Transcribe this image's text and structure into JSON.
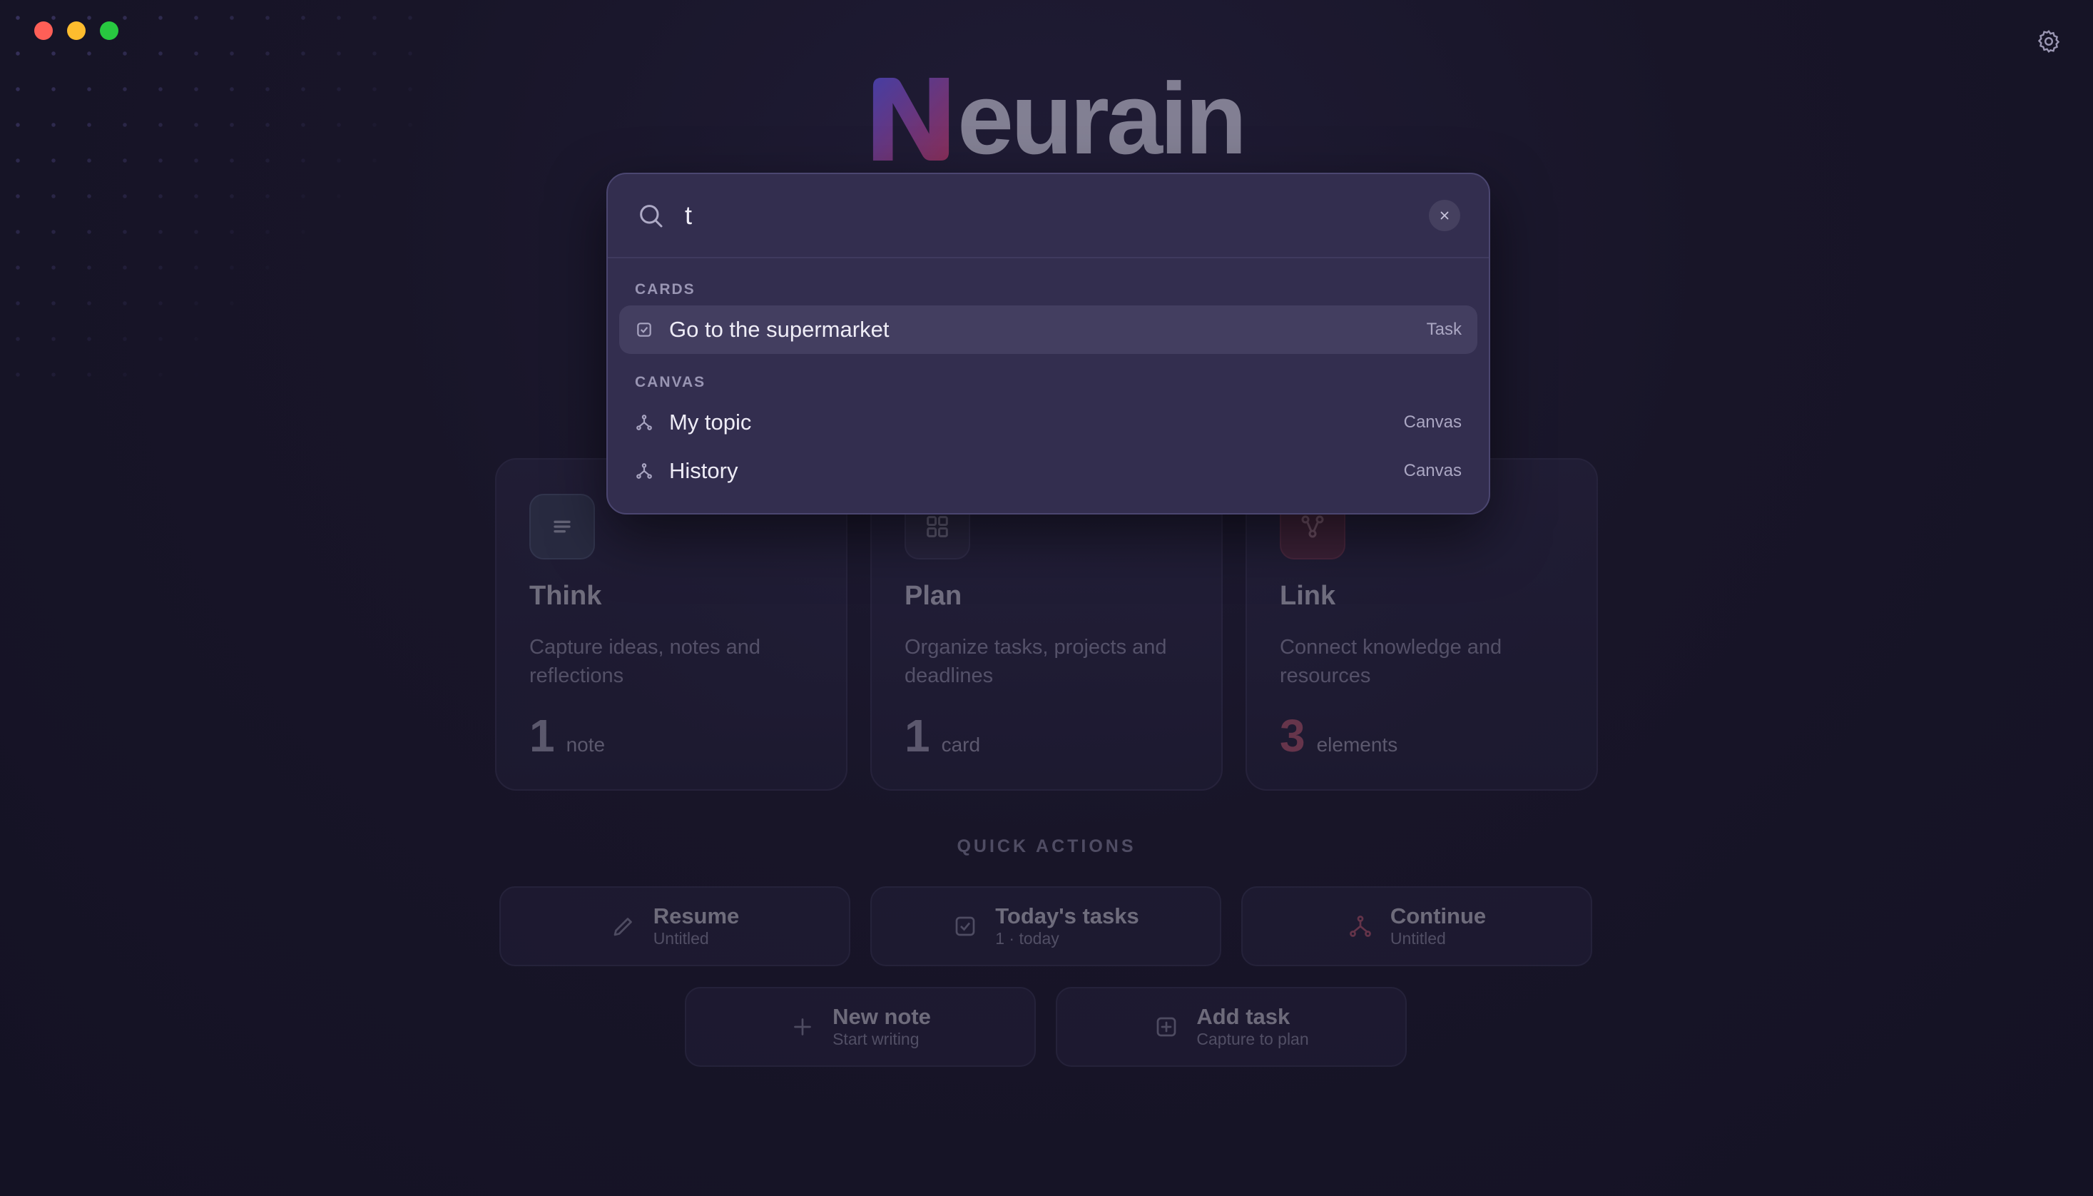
{
  "app": {
    "logo_text": "eurain",
    "logo_letter": "N"
  },
  "cards": [
    {
      "title": "Think",
      "description": "Capture ideas, notes and reflections",
      "count": "1",
      "unit": "note",
      "icon": "lines-icon"
    },
    {
      "title": "Plan",
      "description": "Organize tasks, projects and deadlines",
      "count": "1",
      "unit": "card",
      "icon": "grid-icon"
    },
    {
      "title": "Link",
      "description": "Connect knowledge and resources",
      "count": "3",
      "unit": "elements",
      "icon": "nodes-icon"
    }
  ],
  "quick_actions": {
    "title": "QUICK ACTIONS",
    "items": [
      {
        "label": "Resume",
        "sub": "Untitled",
        "icon": "pencil-icon"
      },
      {
        "label": "Today's tasks",
        "sub": "1 · today",
        "icon": "checkbox-icon"
      },
      {
        "label": "Continue",
        "sub": "Untitled",
        "icon": "fork-icon"
      },
      {
        "label": "New note",
        "sub": "Start writing",
        "icon": "plus-icon"
      },
      {
        "label": "Add task",
        "sub": "Capture to plan",
        "icon": "plus-square-icon"
      }
    ]
  },
  "search": {
    "query": "t",
    "sections": [
      {
        "label": "CARDS",
        "results": [
          {
            "label": "Go to the supermarket",
            "type": "Task"
          }
        ]
      },
      {
        "label": "CANVAS",
        "results": [
          {
            "label": "My topic",
            "type": "Canvas"
          },
          {
            "label": "History",
            "type": "Canvas"
          }
        ]
      }
    ]
  },
  "colors": {
    "accent_red": "#d0607a",
    "background": "#181528",
    "popup": "#332e4f"
  }
}
